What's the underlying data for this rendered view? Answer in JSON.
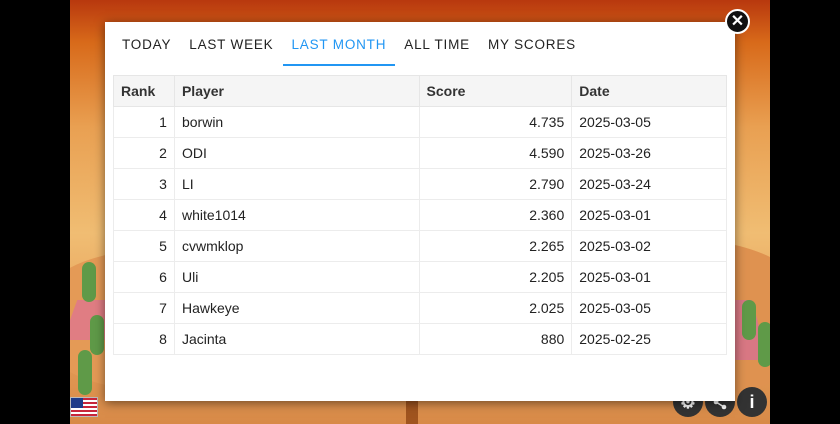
{
  "tabs": [
    {
      "label": "TODAY",
      "active": false
    },
    {
      "label": "LAST WEEK",
      "active": false
    },
    {
      "label": "LAST MONTH",
      "active": true
    },
    {
      "label": "ALL TIME",
      "active": false
    },
    {
      "label": "MY SCORES",
      "active": false
    }
  ],
  "table": {
    "headers": {
      "rank": "Rank",
      "player": "Player",
      "score": "Score",
      "date": "Date"
    },
    "rows": [
      {
        "rank": "1",
        "player": "borwin",
        "score": "4.735",
        "date": "2025-03-05"
      },
      {
        "rank": "2",
        "player": "ODI",
        "score": "4.590",
        "date": "2025-03-26"
      },
      {
        "rank": "3",
        "player": "LI",
        "score": "2.790",
        "date": "2025-03-24"
      },
      {
        "rank": "4",
        "player": "white1014",
        "score": "2.360",
        "date": "2025-03-01"
      },
      {
        "rank": "5",
        "player": "cvwmklop",
        "score": "2.265",
        "date": "2025-03-02"
      },
      {
        "rank": "6",
        "player": "Uli",
        "score": "2.205",
        "date": "2025-03-01"
      },
      {
        "rank": "7",
        "player": "Hawkeye",
        "score": "2.025",
        "date": "2025-03-05"
      },
      {
        "rank": "8",
        "player": "Jacinta",
        "score": "880",
        "date": "2025-02-25"
      }
    ]
  },
  "icons": {
    "close": "close-icon",
    "flag": "us-flag-icon",
    "settings": "gear-icon",
    "share": "share-icon",
    "info": "info-icon"
  },
  "colors": {
    "accent": "#2196f3"
  }
}
